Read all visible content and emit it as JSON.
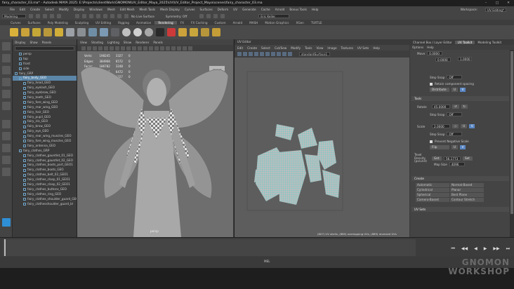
{
  "title_bar": {
    "title": "fairy_character_03.ma* - Autodesk MAYA 2025: E:\\Projects\\clientWork\\GNOMON\\UV_Editor_Maya_2025\\UV\\UV_Editor_Project_Maya\\scenes\\fairy_character_03.ma"
  },
  "menubar": {
    "items": [
      "File",
      "Edit",
      "Create",
      "Select",
      "Modify",
      "Display",
      "Windows",
      "Mesh",
      "Edit Mesh",
      "Mesh Tools",
      "Mesh Display",
      "Curves",
      "Surfaces",
      "Deform",
      "UV",
      "Generate",
      "Cache",
      "Arnold",
      "Bonus Tools",
      "Help"
    ],
    "workspace_label": "Workspace:",
    "workspace_value": "UV Editing*"
  },
  "status_line": {
    "mode": "Modeling",
    "live_surface": "No Live Surface",
    "symmetry": "Symmetry: Off",
    "user": "Eric Keller"
  },
  "shelf_tabs": {
    "items": [
      "Curves",
      "Surfaces",
      "Poly Modeling",
      "Sculpting",
      "UV Editing",
      "Rigging",
      "Animation",
      "Rendering",
      "FX",
      "FX Caching",
      "Custom",
      "Arnold",
      "MASH",
      "Motion Graphics",
      "XGen",
      "TURTLE"
    ],
    "active": "Rendering"
  },
  "outliner": {
    "menu": [
      "Display",
      "Show",
      "Panels"
    ],
    "search_placeholder": "Search...",
    "items": [
      {
        "label": "persp",
        "indent": 1
      },
      {
        "label": "top",
        "indent": 1
      },
      {
        "label": "front",
        "indent": 1
      },
      {
        "label": "side",
        "indent": 1
      },
      {
        "label": "fairy_GRP",
        "indent": 0
      },
      {
        "label": "fairy_body_GEO",
        "indent": 1,
        "selected": true
      },
      {
        "label": "fairy_head_GEO",
        "indent": 2
      },
      {
        "label": "fairy_eyelash_GEO",
        "indent": 2
      },
      {
        "label": "fairy_eyebrow_GEO",
        "indent": 2
      },
      {
        "label": "fairy_teeth_GEO",
        "indent": 2
      },
      {
        "label": "fairy_fore_wing_GEO",
        "indent": 2
      },
      {
        "label": "fairy_rear_wing_GEO",
        "indent": 2
      },
      {
        "label": "fairy_hair_GEO",
        "indent": 2
      },
      {
        "label": "fairy_pupil_GEO",
        "indent": 2
      },
      {
        "label": "fairy_iris_GEO",
        "indent": 2
      },
      {
        "label": "fairy_brow_GEO",
        "indent": 2
      },
      {
        "label": "fairy_eye_GEO",
        "indent": 2
      },
      {
        "label": "fairy_rear_wing_muscles_GEO",
        "indent": 2
      },
      {
        "label": "fairy_fore_wing_muscles_GEO",
        "indent": 2
      },
      {
        "label": "fairy_antenna_GEO",
        "indent": 2
      },
      {
        "label": "fairy_clothes_GRP",
        "indent": 1
      },
      {
        "label": "fairy_clothes_gauntlet_01_GEO",
        "indent": 2
      },
      {
        "label": "fairy_clothes_gauntlet_02_GEO",
        "indent": 2
      },
      {
        "label": "fairy_clothes_boots_part_GEO1",
        "indent": 2
      },
      {
        "label": "fairy_clothes_boots_GEO",
        "indent": 2
      },
      {
        "label": "fairy_clothes_belt_02_GEO1",
        "indent": 2
      },
      {
        "label": "fairy_clothes_clasp_01_GEO1",
        "indent": 2
      },
      {
        "label": "fairy_clothes_clasp_02_GEO1",
        "indent": 2
      },
      {
        "label": "fairy_clothes_buttons_GEO",
        "indent": 2
      },
      {
        "label": "fairy_clothes_ring_GEO",
        "indent": 2
      },
      {
        "label": "fairy_clothes_shoulder_guard_GEO",
        "indent": 2
      },
      {
        "label": "fairy_clothesshoulder_guard_bl",
        "indent": 2
      }
    ]
  },
  "viewport": {
    "menu": [
      "View",
      "Shading",
      "Lighting",
      "Show",
      "Renderer",
      "Panels"
    ],
    "hud": {
      "rows": [
        {
          "label": "Verts:",
          "a": "198245",
          "b": "3327",
          "c": "0"
        },
        {
          "label": "Edges:",
          "a": "384968",
          "b": "6572",
          "c": "0"
        },
        {
          "label": "Faces:",
          "a": "186782",
          "b": "3248",
          "c": "0"
        },
        {
          "label": "Tris:",
          "a": "357651",
          "b": "6472",
          "c": "0"
        },
        {
          "label": "UVs:",
          "a": "195051",
          "b": "3327",
          "c": "0"
        }
      ]
    },
    "view_cube_label": "FRONT",
    "camera_label": "persp"
  },
  "uv_editor": {
    "title": "UV Editor",
    "menu": [
      "Edit",
      "Create",
      "Select",
      "Cut/Sew",
      "Modify",
      "Tools",
      "View",
      "Image",
      "Textures",
      "UV Sets",
      "Help"
    ],
    "uv_set": "standardSurface1",
    "status": "(807) UV shells, (889) overlapping UVs, (889) reversed UVs"
  },
  "side_panel": {
    "tabs": [
      "Channel Box / Layer Editor",
      "UV Toolkit",
      "Modeling Toolkit"
    ],
    "active_tab": "UV Toolkit",
    "submenu": [
      "Options",
      "Help"
    ],
    "move_label": "Move",
    "move_u": "0.0000",
    "move_v": "0.0000",
    "move_step": "1.0000",
    "step_snap_label": "Step Snap",
    "step_snap_value": "Off",
    "retain_spacing": "Retain component spacing",
    "distribute_label": "Distribute",
    "u_label": "U",
    "v_label": "V",
    "tools_section": "Tools",
    "rotate_label": "Rotate",
    "rotate_value": "45.0000",
    "rotate_snap": "Off",
    "scale_label": "Scale",
    "scale_value": "2.0000",
    "scale_snap": "Off",
    "prevent_negative": "Prevent Negative Scale",
    "flip_label": "Flip",
    "texel_density_label": "Texel Density (px/unit)",
    "get_label": "Get",
    "texel_value": "56.1773",
    "set_label": "Set",
    "map_size_label": "Map Size",
    "map_size_value": "4096",
    "create_section": "Create",
    "create_items": [
      "Automatic",
      "Normal-Based",
      "Cylindrical",
      "Planar",
      "Spherical",
      "Best Plane",
      "Camera-Based",
      "Contour Stretch"
    ],
    "uv_sets_section": "UV Sets"
  },
  "cmd_line": {
    "mel_label": "MEL"
  },
  "watermark": {
    "line1": "GNOMON",
    "line2": "WORKSHOP"
  },
  "colors": {
    "uv_shell": "#3fd9d4",
    "selection": "#5b86a8",
    "accent_blue": "#5a87c4"
  }
}
